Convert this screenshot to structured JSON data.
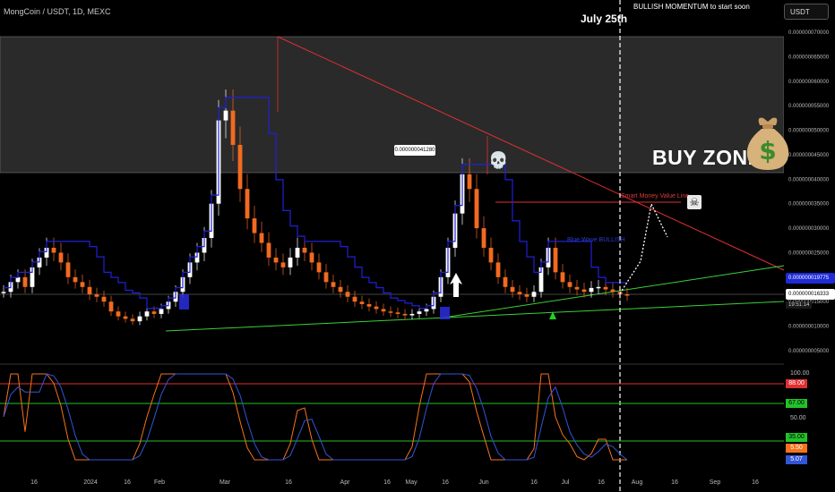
{
  "header": {
    "symbol": "MongCoin / USDT, 1D, MEXC",
    "currency_button": "USDT"
  },
  "annotations": {
    "top_note": "BULLISH MOMENTUM to start soon",
    "date_label": "July 25th",
    "buy_zone": "BUY ZONE",
    "smart_money_label": "Smart Money Value Line",
    "blue_wave_label": "Blue Wave BULLISH",
    "price_callout": "0.000000041280",
    "moneybag_icon": "money-bag-icon",
    "skull_icon": "skull-icon",
    "crossbones_icon": "skull-crossbones-icon"
  },
  "price_axis": {
    "ticks": [
      "0.000000070000",
      "0.000000065000",
      "0.000000060000",
      "0.000000055000",
      "0.000000050000",
      "0.000000045000",
      "0.000000040000",
      "0.000000035000",
      "0.000000030000",
      "0.000000025000",
      "0.000000020000",
      "0.000000015000",
      "0.000000010000",
      "0.000000005000"
    ],
    "blue_tag": "0.000000019775",
    "white_tag": "0.000000016333",
    "countdown": "19:51:14"
  },
  "oscillator_axis": {
    "ticks": [
      "100.00",
      "88.00",
      "67.00",
      "50.00",
      "35.00",
      "5.50",
      "5.07"
    ],
    "levels": {
      "upper_red": 88,
      "upper_green": 67,
      "lower_green": 35
    },
    "tags": [
      {
        "value": "88.00",
        "color": "#e03030"
      },
      {
        "value": "67.00",
        "color": "#22c22a"
      },
      {
        "value": "35.00",
        "color": "#22c22a"
      },
      {
        "value": "5.50",
        "color": "#f5731a"
      },
      {
        "value": "5.07",
        "color": "#3255d8"
      }
    ]
  },
  "time_axis": [
    "16",
    "2024",
    "16",
    "Feb",
    "Mar",
    "16",
    "Apr",
    "16",
    "May",
    "16",
    "Jun",
    "16",
    "Jul",
    "16",
    "Aug",
    "16",
    "Sep",
    "16"
  ],
  "colors": {
    "candle_up": "#ffffff",
    "candle_down": "#f26a21",
    "blue_line": "#2020d8",
    "red_line": "#e03030",
    "green_line": "#3ad13a",
    "zone_fill": "#2a2a2a"
  },
  "chart_data": {
    "type": "line",
    "title": "MongCoin / USDT, 1D, MEXC",
    "xlabel": "",
    "ylabel": "",
    "ylim": [
      5e-09,
      7e-08
    ],
    "buy_zone_range": [
      4.1e-08,
      6.9e-08
    ],
    "series": [
      {
        "values": [
          1.7e-08,
          1.9e-08,
          2e-08,
          1.8e-08,
          2.2e-08,
          2.4e-08,
          2.6e-08,
          2.5e-08,
          2.3e-08,
          2e-08,
          1.9e-08,
          1.8e-08,
          1.65e-08,
          1.6e-08,
          1.5e-08,
          1.3e-08,
          1.2e-08,
          1.15e-08,
          1.1e-08,
          1.2e-08,
          1.3e-08,
          1.25e-08,
          1.35e-08,
          1.5e-08,
          1.7e-08,
          2e-08,
          2.3e-08,
          2.5e-08,
          2.8e-08,
          3.5e-08,
          5.2e-08,
          5.4e-08,
          4.7e-08,
          3.8e-08,
          3.2e-08,
          2.9e-08,
          2.7e-08,
          2.4e-08,
          2.3e-08,
          2.2e-08,
          2.4e-08,
          2.6e-08,
          2.5e-08,
          2.3e-08,
          2.1e-08,
          1.9e-08,
          1.8e-08,
          1.7e-08,
          1.6e-08,
          1.5e-08,
          1.45e-08,
          1.4e-08,
          1.35e-08,
          1.3e-08,
          1.28e-08,
          1.25e-08,
          1.22e-08,
          1.25e-08,
          1.3e-08,
          1.35e-08,
          1.6e-08,
          2e-08,
          2.6e-08,
          3.3e-08,
          4.1e-08,
          3.8e-08,
          3e-08,
          2.6e-08,
          2.3e-08,
          2e-08,
          1.8e-08,
          1.7e-08,
          1.65e-08,
          1.6e-08,
          1.7e-08,
          2.2e-08,
          2.6e-08,
          2.1e-08,
          1.9e-08,
          1.8e-08,
          1.75e-08,
          1.7e-08,
          1.78e-08,
          1.8e-08,
          1.75e-08,
          1.7e-08,
          1.65e-08,
          1.63e-08
        ]
      }
    ]
  }
}
